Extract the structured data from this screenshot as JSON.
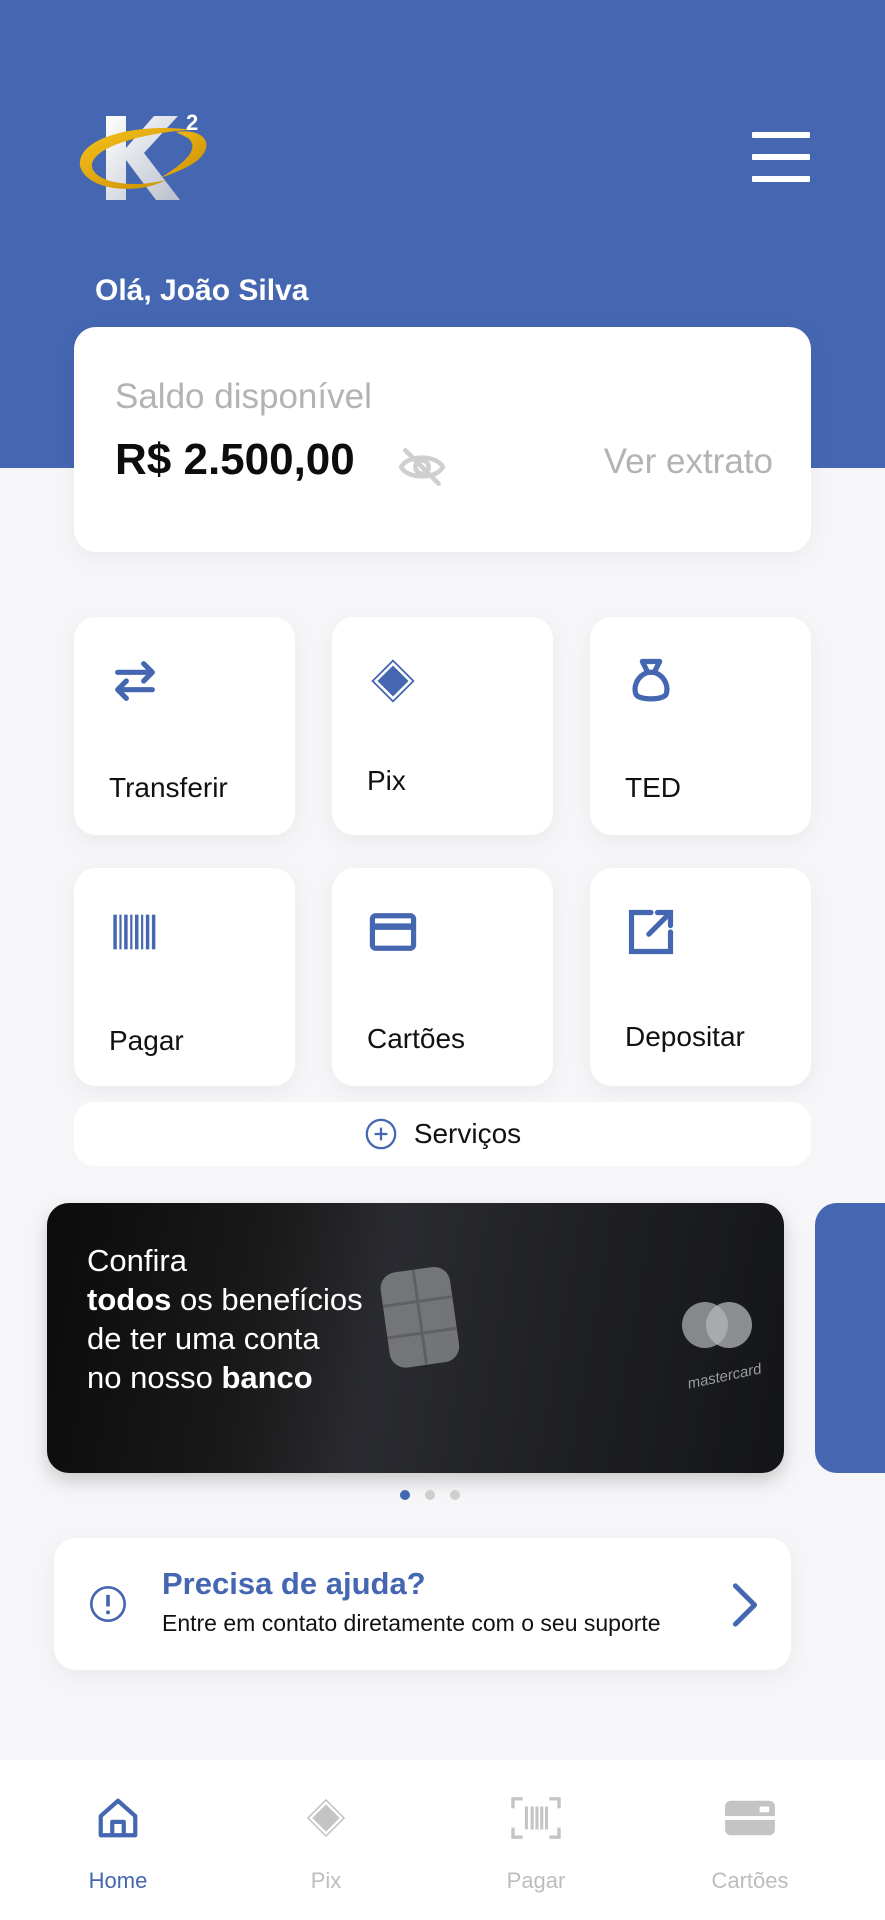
{
  "header": {
    "greeting": "Olá, João Silva",
    "logo_icon": "k2-logo-icon",
    "menu_icon": "hamburger-menu-icon"
  },
  "balance": {
    "label": "Saldo disponível",
    "value": "R$ 2.500,00",
    "visibility_icon": "eye-off-icon",
    "statement_link": "Ver extrato"
  },
  "actions": [
    {
      "label": "Transferir",
      "icon": "transfer-arrows-icon"
    },
    {
      "label": "Pix",
      "icon": "pix-icon"
    },
    {
      "label": "TED",
      "icon": "money-bag-icon"
    },
    {
      "label": "Pagar",
      "icon": "barcode-icon"
    },
    {
      "label": "Cartões",
      "icon": "credit-card-icon"
    },
    {
      "label": "Depositar",
      "icon": "external-link-icon"
    }
  ],
  "services": {
    "label": "Serviços",
    "icon": "plus-circle-icon"
  },
  "banner": {
    "line1": "Confira",
    "line2_bold": "todos",
    "line2_rest": " os benefícios",
    "line3": "de ter uma conta",
    "line4_rest": "no nosso ",
    "line4_bold": "banco",
    "card_brand": "mastercard",
    "page_count": 3,
    "active_page": 1
  },
  "help": {
    "title": "Precisa de ajuda?",
    "subtitle": "Entre em contato diretamente com o seu suporte",
    "icon": "alert-circle-icon",
    "chevron": "chevron-right-icon"
  },
  "tabbar": {
    "items": [
      {
        "label": "Home",
        "icon": "home-icon",
        "active": true
      },
      {
        "label": "Pix",
        "icon": "pix-icon",
        "active": false
      },
      {
        "label": "Pagar",
        "icon": "barcode-scan-icon",
        "active": false
      },
      {
        "label": "Cartões",
        "icon": "card-icon",
        "active": false
      }
    ]
  },
  "colors": {
    "brand": "#4566b1",
    "background": "#f6f6f8",
    "muted_text": "#b3b3b3",
    "logo_gold": "#e0a800"
  }
}
